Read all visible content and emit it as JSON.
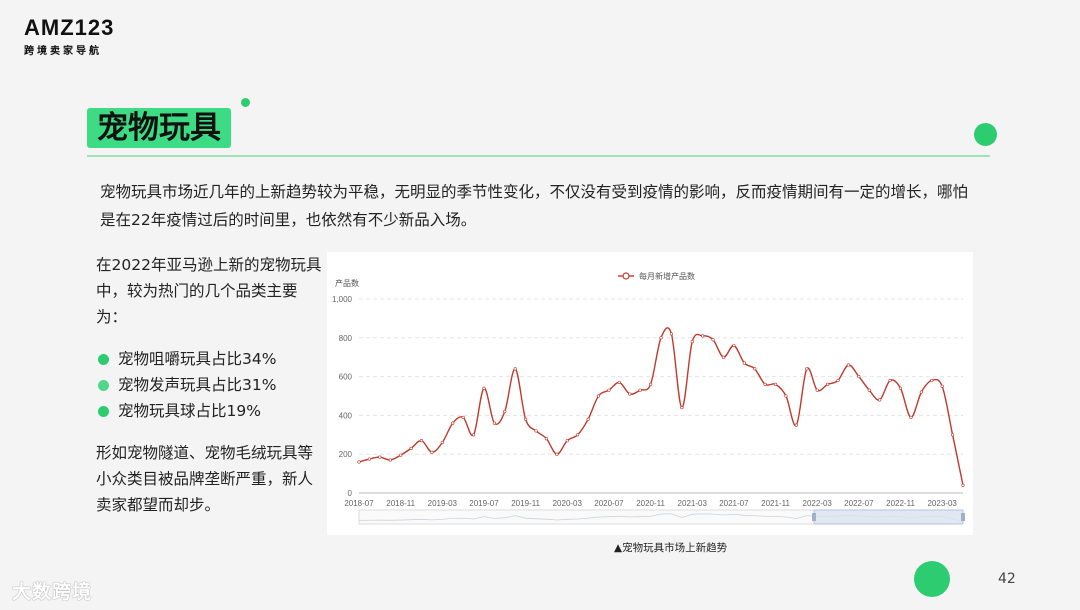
{
  "logo": {
    "main": "AMZ123",
    "sub": "跨境卖家导航"
  },
  "slide": {
    "title": "宠物玩具",
    "intro": "宠物玩具市场近几年的上新趋势较为平稳，无明显的季节性变化，不仅没有受到疫情的影响，反而疫情期间有一定的增长，哪怕是在22年疫情过后的时间里，也依然有不少新品入场。",
    "side_intro": "在2022年亚马逊上新的宠物玩具中，较为热门的几个品类主要为：",
    "bullets": [
      "宠物咀嚼玩具占比34%",
      "宠物发声玩具占比31%",
      "宠物玩具球占比19%"
    ],
    "side_outro": "形如宠物隧道、宠物毛绒玩具等小众类目被品牌垄断严重，新人卖家都望而却步。",
    "caption": "▲宠物玩具市场上新趋势",
    "watermark": "大数跨境",
    "page_number": "42"
  },
  "colors": {
    "accent": "#3ddc84",
    "line": "#c0392b"
  },
  "chart_data": {
    "type": "line",
    "ylabel": "产品数",
    "ylim": [
      0,
      1000
    ],
    "yticks": [
      "0",
      "200",
      "400",
      "600",
      "800",
      "1,000"
    ],
    "xticks": [
      "2018-07",
      "2018-11",
      "2019-03",
      "2019-07",
      "2019-11",
      "2020-03",
      "2020-07",
      "2020-11",
      "2021-03",
      "2021-07",
      "2021-11",
      "2022-03",
      "2022-07",
      "2022-11",
      "2023-03"
    ],
    "legend_position": "top-center",
    "series": [
      {
        "name": "每月新增产品数",
        "x": [
          "2018-07",
          "2018-08",
          "2018-09",
          "2018-10",
          "2018-11",
          "2018-12",
          "2019-01",
          "2019-02",
          "2019-03",
          "2019-04",
          "2019-05",
          "2019-06",
          "2019-07",
          "2019-08",
          "2019-09",
          "2019-10",
          "2019-11",
          "2019-12",
          "2020-01",
          "2020-02",
          "2020-03",
          "2020-04",
          "2020-05",
          "2020-06",
          "2020-07",
          "2020-08",
          "2020-09",
          "2020-10",
          "2020-11",
          "2020-12",
          "2021-01",
          "2021-02",
          "2021-03",
          "2021-04",
          "2021-05",
          "2021-06",
          "2021-07",
          "2021-08",
          "2021-09",
          "2021-10",
          "2021-11",
          "2021-12",
          "2022-01",
          "2022-02",
          "2022-03",
          "2022-04",
          "2022-05",
          "2022-06",
          "2022-07",
          "2022-08",
          "2022-09",
          "2022-10",
          "2022-11",
          "2022-12",
          "2023-01",
          "2023-02",
          "2023-03",
          "2023-04",
          "2023-05"
        ],
        "values": [
          160,
          175,
          185,
          170,
          195,
          230,
          270,
          210,
          260,
          360,
          390,
          300,
          540,
          360,
          420,
          640,
          380,
          320,
          280,
          200,
          270,
          300,
          380,
          500,
          530,
          570,
          510,
          530,
          560,
          800,
          820,
          440,
          780,
          810,
          790,
          700,
          760,
          670,
          640,
          560,
          560,
          500,
          350,
          640,
          530,
          560,
          580,
          660,
          600,
          530,
          480,
          580,
          540,
          390,
          520,
          580,
          550,
          300,
          40
        ]
      }
    ]
  }
}
